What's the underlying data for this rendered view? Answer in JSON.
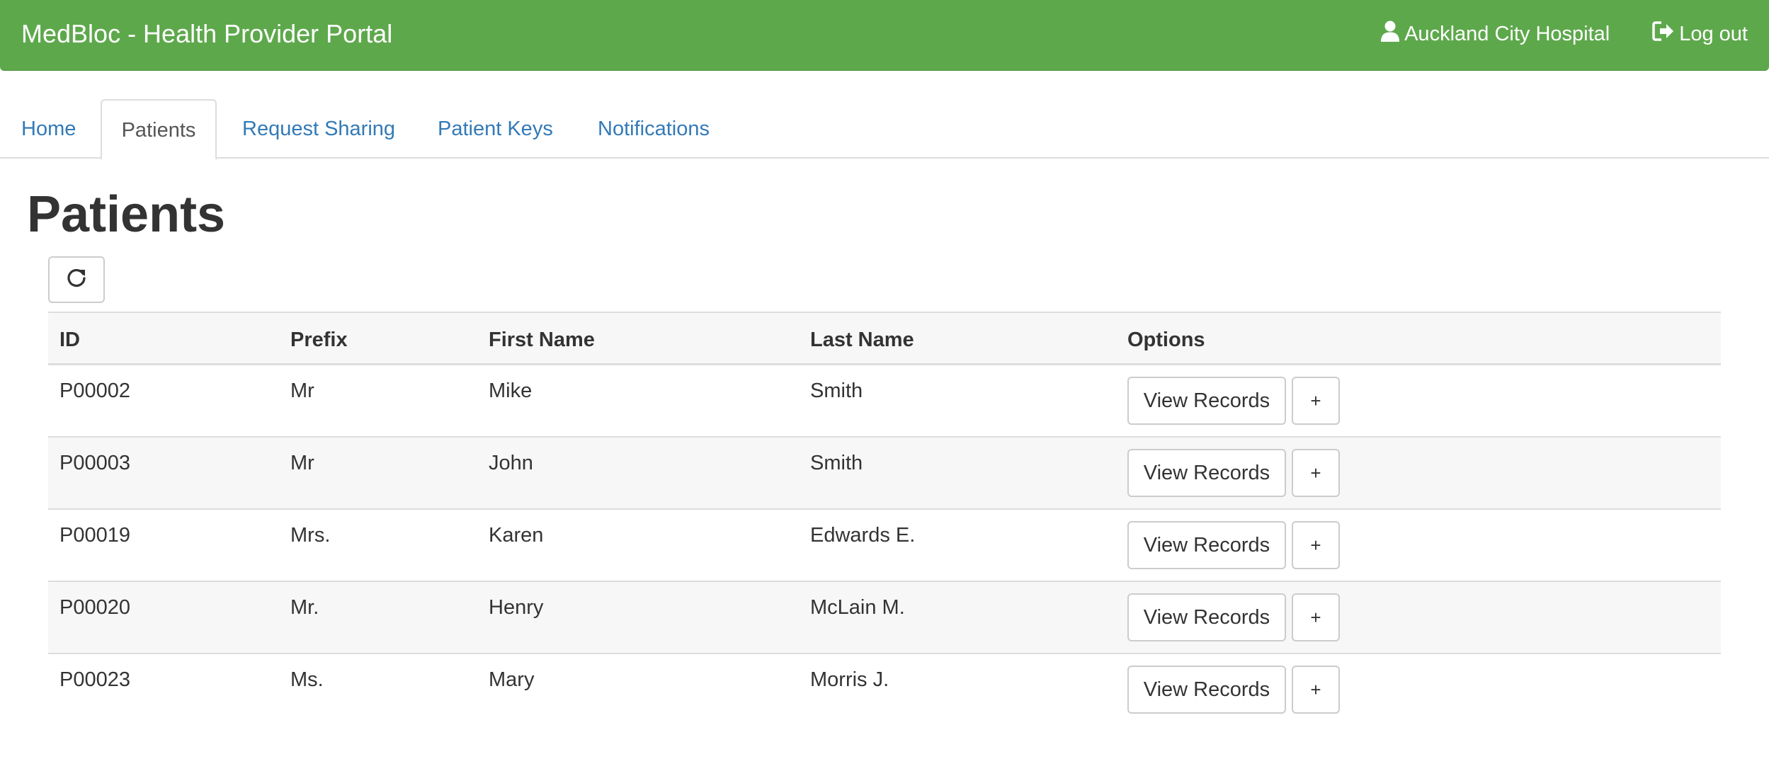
{
  "navbar": {
    "brand": "MedBloc - Health Provider Portal",
    "user_icon": "user-icon",
    "user_label": "Auckland City Hospital",
    "logout_icon": "log-out-icon",
    "logout_label": "Log out",
    "background": "#5ea84c"
  },
  "tabs": [
    {
      "label": "Home",
      "active": false
    },
    {
      "label": "Patients",
      "active": true
    },
    {
      "label": "Request Sharing",
      "active": false
    },
    {
      "label": "Patient Keys",
      "active": false
    },
    {
      "label": "Notifications",
      "active": false
    }
  ],
  "page": {
    "title": "Patients",
    "refresh_icon": "refresh-icon"
  },
  "table": {
    "headers": {
      "id": "ID",
      "prefix": "Prefix",
      "first_name": "First Name",
      "last_name": "Last Name",
      "options": "Options"
    },
    "rows": [
      {
        "id": "P00002",
        "prefix": "Mr",
        "first_name": "Mike",
        "last_name": "Smith"
      },
      {
        "id": "P00003",
        "prefix": "Mr",
        "first_name": "John",
        "last_name": "Smith"
      },
      {
        "id": "P00019",
        "prefix": "Mrs.",
        "first_name": "Karen",
        "last_name": "Edwards E."
      },
      {
        "id": "P00020",
        "prefix": "Mr.",
        "first_name": "Henry",
        "last_name": "McLain M."
      },
      {
        "id": "P00023",
        "prefix": "Ms.",
        "first_name": "Mary",
        "last_name": "Morris J."
      }
    ],
    "view_records_label": "View Records",
    "add_label": "+"
  },
  "colors": {
    "link": "#337ab7",
    "text": "#333333",
    "stripe": "#f7f7f7",
    "border": "#dddddd"
  }
}
